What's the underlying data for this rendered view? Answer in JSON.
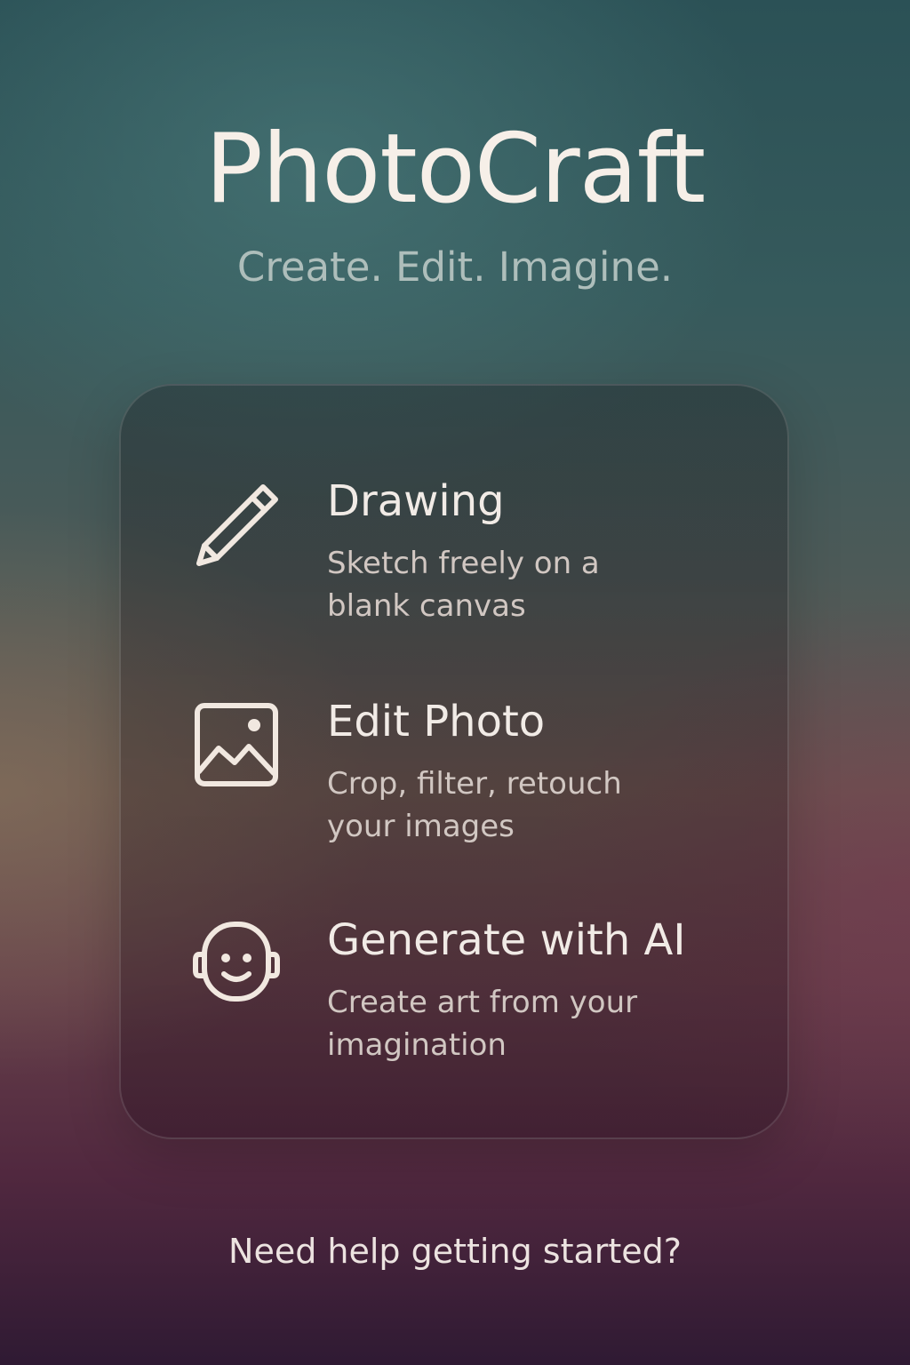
{
  "app": {
    "title": "PhotoCraft",
    "tagline": "Create. Edit. Imagine."
  },
  "options": [
    {
      "icon": "pencil-icon",
      "title": "Drawing",
      "description": "Sketch freely on a blank canvas"
    },
    {
      "icon": "image-icon",
      "title": "Edit Photo",
      "description": "Crop, filter, retouch your images"
    },
    {
      "icon": "robot-face-icon",
      "title": "Generate with AI",
      "description": "Create art from your imagination"
    }
  ],
  "footer": {
    "help_link": "Need help getting started?"
  },
  "colors": {
    "text_primary": "#f3ece6",
    "tagline": "#aebebb",
    "gradient_top": "#2b5156",
    "gradient_bottom": "#2f1a33"
  }
}
